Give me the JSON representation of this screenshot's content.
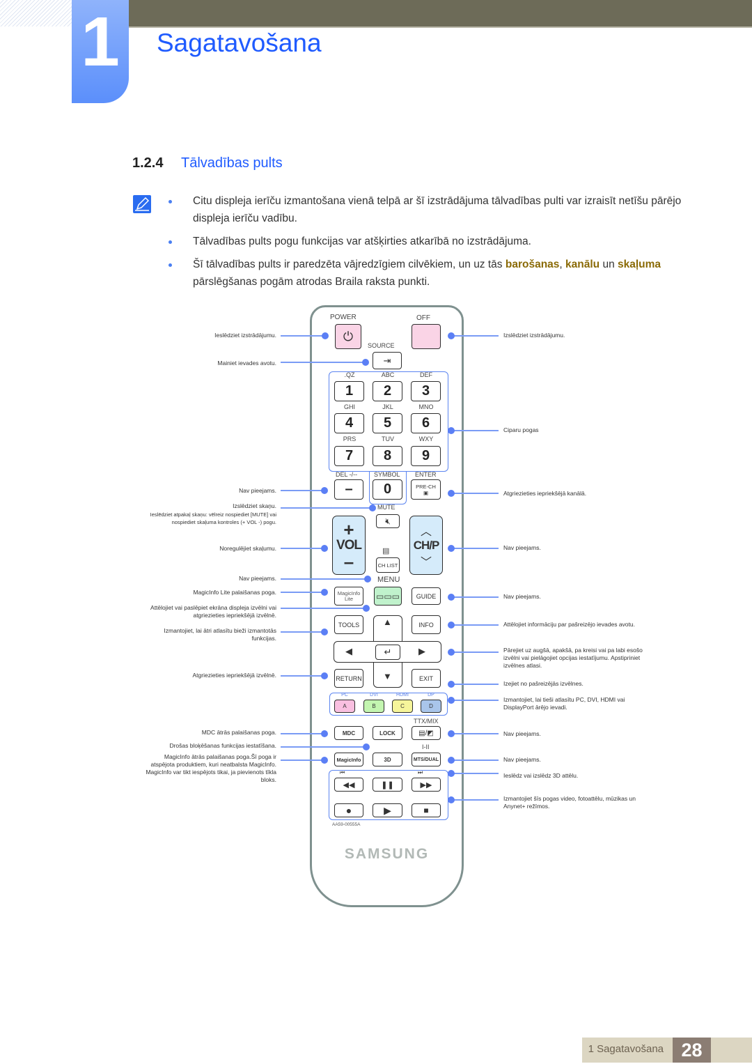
{
  "chapter": {
    "number": "1",
    "title": "Sagatavošana"
  },
  "section": {
    "number": "1.2.4",
    "title": "Tālvadības pults"
  },
  "notes": [
    {
      "text": "Citu displeja ierīču izmantošana vienā telpā ar šī izstrādājuma tālvadības pulti var izraisīt netīšu pārējo displeja ierīču vadību."
    },
    {
      "text": "Tālvadības pults pogu funkcijas var atšķirties atkarībā no izstrādājuma."
    },
    {
      "pre": "Šī tālvadības pults ir paredzēta vājredzīgiem cilvēkiem, un uz tās ",
      "hl1": "barošanas",
      "sep1": ", ",
      "hl2": "kanālu",
      "sep2": " un ",
      "hl3": "skaļuma",
      "post": " pārslēgšanas pogām atrodas Braila raksta punkti."
    }
  ],
  "remote": {
    "power": "POWER",
    "off": "OFF",
    "source": "SOURCE",
    "letters": [
      ".QZ",
      "ABC",
      "DEF",
      "GHI",
      "JKL",
      "MNO",
      "PRS",
      "TUV",
      "WXY"
    ],
    "digits": [
      "1",
      "2",
      "3",
      "4",
      "5",
      "6",
      "7",
      "8",
      "9"
    ],
    "del": "DEL -/--",
    "dash": "–",
    "symbol": "SYMBOL",
    "zero": "0",
    "enter": "ENTER",
    "prech": "PRE-CH",
    "mute": "MUTE",
    "vol": "VOL",
    "plus": "+",
    "minus": "–",
    "chp": "CH/P",
    "chlist": "CH LIST",
    "menu": "MENU",
    "magicinfo_lite": "MagicInfo Lite",
    "guide": "GUIDE",
    "tools": "TOOLS",
    "info": "INFO",
    "return": "RETURN",
    "exit": "EXIT",
    "inputs": [
      {
        "top": "PC",
        "key": "A",
        "color": "#f9bfe0"
      },
      {
        "top": "DVI",
        "key": "B",
        "color": "#c3f5b0"
      },
      {
        "top": "HDMI",
        "key": "C",
        "color": "#f6f59a"
      },
      {
        "top": "DP",
        "key": "D",
        "color": "#a9c5ea"
      }
    ],
    "ttxmix": "TTX/MIX",
    "mdc": "MDC",
    "lock": "LOCK",
    "i_ii": "I-II",
    "magicinfo": "MagicInfo",
    "three_d": "3D",
    "mts": "MTS/DUAL",
    "model": "AA59-00555A",
    "brand": "SAMSUNG"
  },
  "callouts_left": [
    "Ieslēdziet izstrādājumu.",
    "Mainiet ievades avotu.",
    "Nav pieejams.",
    "Izslēdziet skaņu.",
    "Ieslēdziet atpakaļ skaņu: vēlreiz nospiediet [MUTE] vai nospiediet skaļuma kontroles (+ VOL -) pogu.",
    "Noregulējiet skaļumu.",
    "Nav pieejams.",
    "MagicInfo Lite palaišanas poga.",
    "Attēlojiet vai paslēpiet ekrāna displeja izvēlni vai atgriezieties iepriekšējā izvēlnē.",
    "Izmantojiet, lai ātri atlasītu bieži izmantotās funkcijas.",
    "Atgriezieties iepriekšējā izvēlnē.",
    "MDC ātrās palaišanas poga.",
    "Drošas bloķēšanas funkcijas iestatīšana.",
    "MagicInfo ātrās palaišanas poga.Šī poga ir atspējota produktiem, kuri neatbalsta MagicInfo. MagicInfo var tikt iespējots tikai, ja pievienots tīkla bloks."
  ],
  "callouts_right": [
    "Izslēdziet izstrādājumu.",
    "Ciparu pogas",
    "Atgriezieties iepriekšējā kanālā.",
    "Nav pieejams.",
    "Nav pieejams.",
    "Attēlojiet informāciju par pašreizējo ievades avotu.",
    "Pārejiet uz augšā, apakšā, pa kreisi vai pa labi esošo izvēlni vai pielāgojiet opcijas iestatījumu. Apstipriniet izvēlnes atlasi.",
    "Izejiet no pašreizējās izvēlnes.",
    "Izmantojiet, lai tieši atlasītu PC, DVI, HDMI vai DisplayPort ārējo ievadi.",
    "Nav pieejams.",
    "Nav pieejams.",
    "Ieslēdz vai izslēdz 3D attēlu.",
    "Izmantojiet šīs pogas video, fotoattēlu, mūzikas un Anynet+ režīmos."
  ],
  "footer": {
    "chapter": "1 Sagatavošana",
    "page": "28"
  }
}
